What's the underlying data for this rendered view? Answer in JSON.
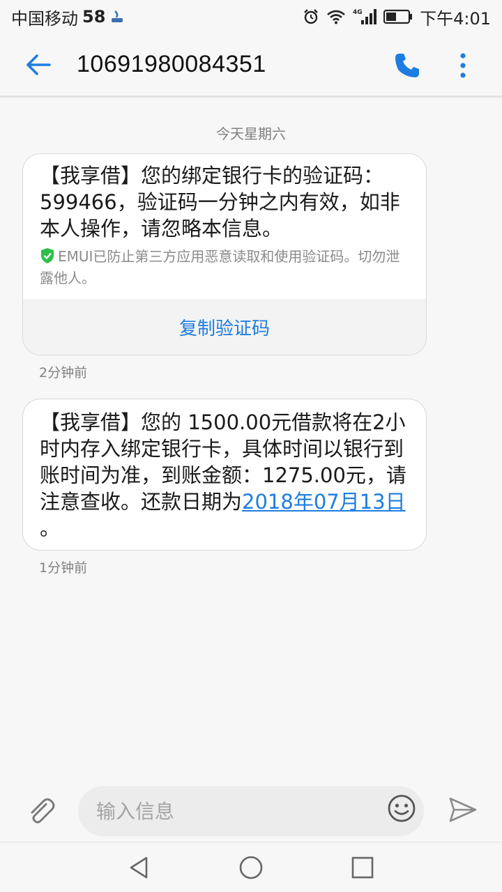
{
  "status_bar": {
    "carrier": "中国移动",
    "carrier_num": "58",
    "network": "4G",
    "time": "下午4:01"
  },
  "header": {
    "title": "10691980084351"
  },
  "thread": {
    "date_separator": "今天星期六",
    "messages": [
      {
        "text": "【我享借】您的绑定银行卡的验证码：599466，验证码一分钟之内有效，如非本人操作，请忽略本信息。",
        "notice": "EMUI已防止第三方应用恶意读取和使用验证码。切勿泄露他人。",
        "action_label": "复制验证码",
        "time_ago": "2分钟前"
      },
      {
        "text_before_link": "【我享借】您的 1500.00元借款将在2小时内存入绑定银行卡，具体时间以银行到账时间为准，到账金额：1275.00元，请注意查收。还款日期为",
        "link_text": "2018年07月13日",
        "text_after_link": " 。",
        "time_ago": "1分钟前"
      }
    ]
  },
  "composer": {
    "placeholder": "输入信息"
  },
  "colors": {
    "accent": "#1e7de0",
    "bubble_bg": "#ffffff",
    "background": "#f7f7f7",
    "secure_green": "#2dbf4a"
  },
  "icons": {
    "back": "arrow-left-icon",
    "call": "phone-icon",
    "more": "more-vertical-icon",
    "attach": "paperclip-icon",
    "emoji": "smiley-icon",
    "send": "send-icon",
    "shield": "shield-check-icon"
  }
}
